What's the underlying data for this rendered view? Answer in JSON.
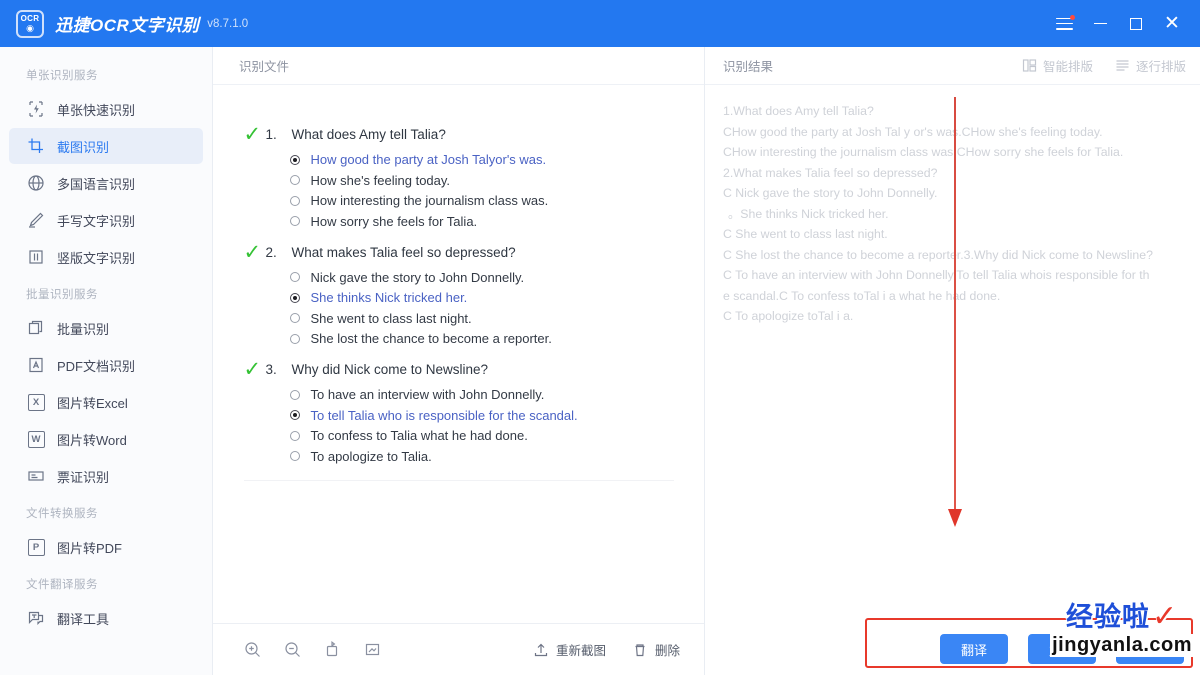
{
  "titlebar": {
    "logo_text": "OCR",
    "app_name": "迅捷OCR文字识别",
    "version": "v8.7.1.0",
    "menu_icon": "hamburger-menu-icon",
    "minimize_icon": "minimize-icon",
    "maximize_icon": "maximize-icon",
    "close_icon": "close-icon",
    "accent_color": "#2378f0"
  },
  "sidebar": {
    "groups": [
      {
        "label": "单张识别服务",
        "items": [
          {
            "label": "单张快速识别",
            "icon": "quick-recognize-icon",
            "active": false
          },
          {
            "label": "截图识别",
            "icon": "screenshot-crop-icon",
            "active": true
          },
          {
            "label": "多国语言识别",
            "icon": "globe-icon",
            "active": false
          },
          {
            "label": "手写文字识别",
            "icon": "pen-icon",
            "active": false
          },
          {
            "label": "竖版文字识别",
            "icon": "vertical-text-icon",
            "active": false
          }
        ]
      },
      {
        "label": "批量识别服务",
        "items": [
          {
            "label": "批量识别",
            "icon": "batch-pages-icon",
            "active": false
          },
          {
            "label": "PDF文档识别",
            "icon": "pdf-file-icon",
            "active": false
          },
          {
            "label": "图片转Excel",
            "icon": "excel-file-icon",
            "active": false
          },
          {
            "label": "图片转Word",
            "icon": "word-file-icon",
            "active": false
          },
          {
            "label": "票证识别",
            "icon": "invoice-icon",
            "active": false
          }
        ]
      },
      {
        "label": "文件转换服务",
        "items": [
          {
            "label": "图片转PDF",
            "icon": "pdf-convert-icon",
            "active": false
          }
        ]
      },
      {
        "label": "文件翻译服务",
        "items": [
          {
            "label": "翻译工具",
            "icon": "translate-icon",
            "active": false
          }
        ]
      }
    ]
  },
  "center_panel": {
    "header_title": "识别文件",
    "document": {
      "questions": [
        {
          "mark": "✓",
          "number": "1.",
          "text": "What does Amy tell Talia?",
          "options": [
            {
              "text": "How good the party at Josh Talyor's was.",
              "selected": true
            },
            {
              "text": "How she's feeling today.",
              "selected": false
            },
            {
              "text": "How interesting the journalism class was.",
              "selected": false
            },
            {
              "text": "How sorry she feels for Talia.",
              "selected": false
            }
          ]
        },
        {
          "mark": "✓",
          "number": "2.",
          "text": "What makes Talia feel so depressed?",
          "options": [
            {
              "text": "Nick gave the story to John Donnelly.",
              "selected": false
            },
            {
              "text": "She thinks Nick tricked her.",
              "selected": true
            },
            {
              "text": "She went to class last night.",
              "selected": false
            },
            {
              "text": "She lost the chance to become a reporter.",
              "selected": false
            }
          ]
        },
        {
          "mark": "✓",
          "number": "3.",
          "text": "Why did Nick come to Newsline?",
          "options": [
            {
              "text": "To have an interview with John Donnelly.",
              "selected": false
            },
            {
              "text": "To tell Talia who is responsible for the scandal.",
              "selected": true
            },
            {
              "text": "To confess to Talia what he had done.",
              "selected": false
            },
            {
              "text": "To apologize to Talia.",
              "selected": false
            }
          ]
        }
      ]
    },
    "toolbar": {
      "zoom_in_icon": "zoom-in-icon",
      "zoom_out_icon": "zoom-out-icon",
      "rotate_icon": "rotate-icon",
      "fit_icon": "fit-to-screen-icon",
      "recapture_label": "重新截图",
      "recapture_icon": "upload-icon",
      "delete_label": "删除",
      "delete_icon": "trash-icon"
    }
  },
  "right_panel": {
    "header_title": "识别结果",
    "layout_buttons": [
      {
        "label": "智能排版",
        "icon": "smart-layout-icon"
      },
      {
        "label": "逐行排版",
        "icon": "line-by-line-layout-icon"
      }
    ],
    "result_lines": [
      "1.What does Amy tell Talia?",
      "CHow good the party at Josh Tal y or's was.CHow she's feeling today.",
      "CHow interesting the journalism class was.CHow sorry she feels for Talia.",
      "2.What makes Talia feel so depressed?",
      "C Nick gave the story to John Donnelly.",
      "。She thinks Nick tricked her.",
      "C She went to class last night.",
      "C She lost the chance to become a reporter.3.Why did Nick come to Newsline?",
      "C To have an interview with John Donnelly.To tell Talia whois responsible for th",
      "e scandal.C To confess toTal i a what he had done.",
      "C To apologize toTal i a."
    ],
    "annotation": {
      "type": "red-down-arrow",
      "color": "#e0362a"
    },
    "actions": [
      {
        "label": "翻译",
        "name": "translate-button"
      },
      {
        "label": "复制",
        "name": "copy-button"
      },
      {
        "label": "",
        "name": "save-button"
      }
    ],
    "highlight_box_color": "#e8392b"
  },
  "watermark": {
    "top_text": "经验啦",
    "check_mark": "✓",
    "bottom_text": "jingyanla.com"
  }
}
